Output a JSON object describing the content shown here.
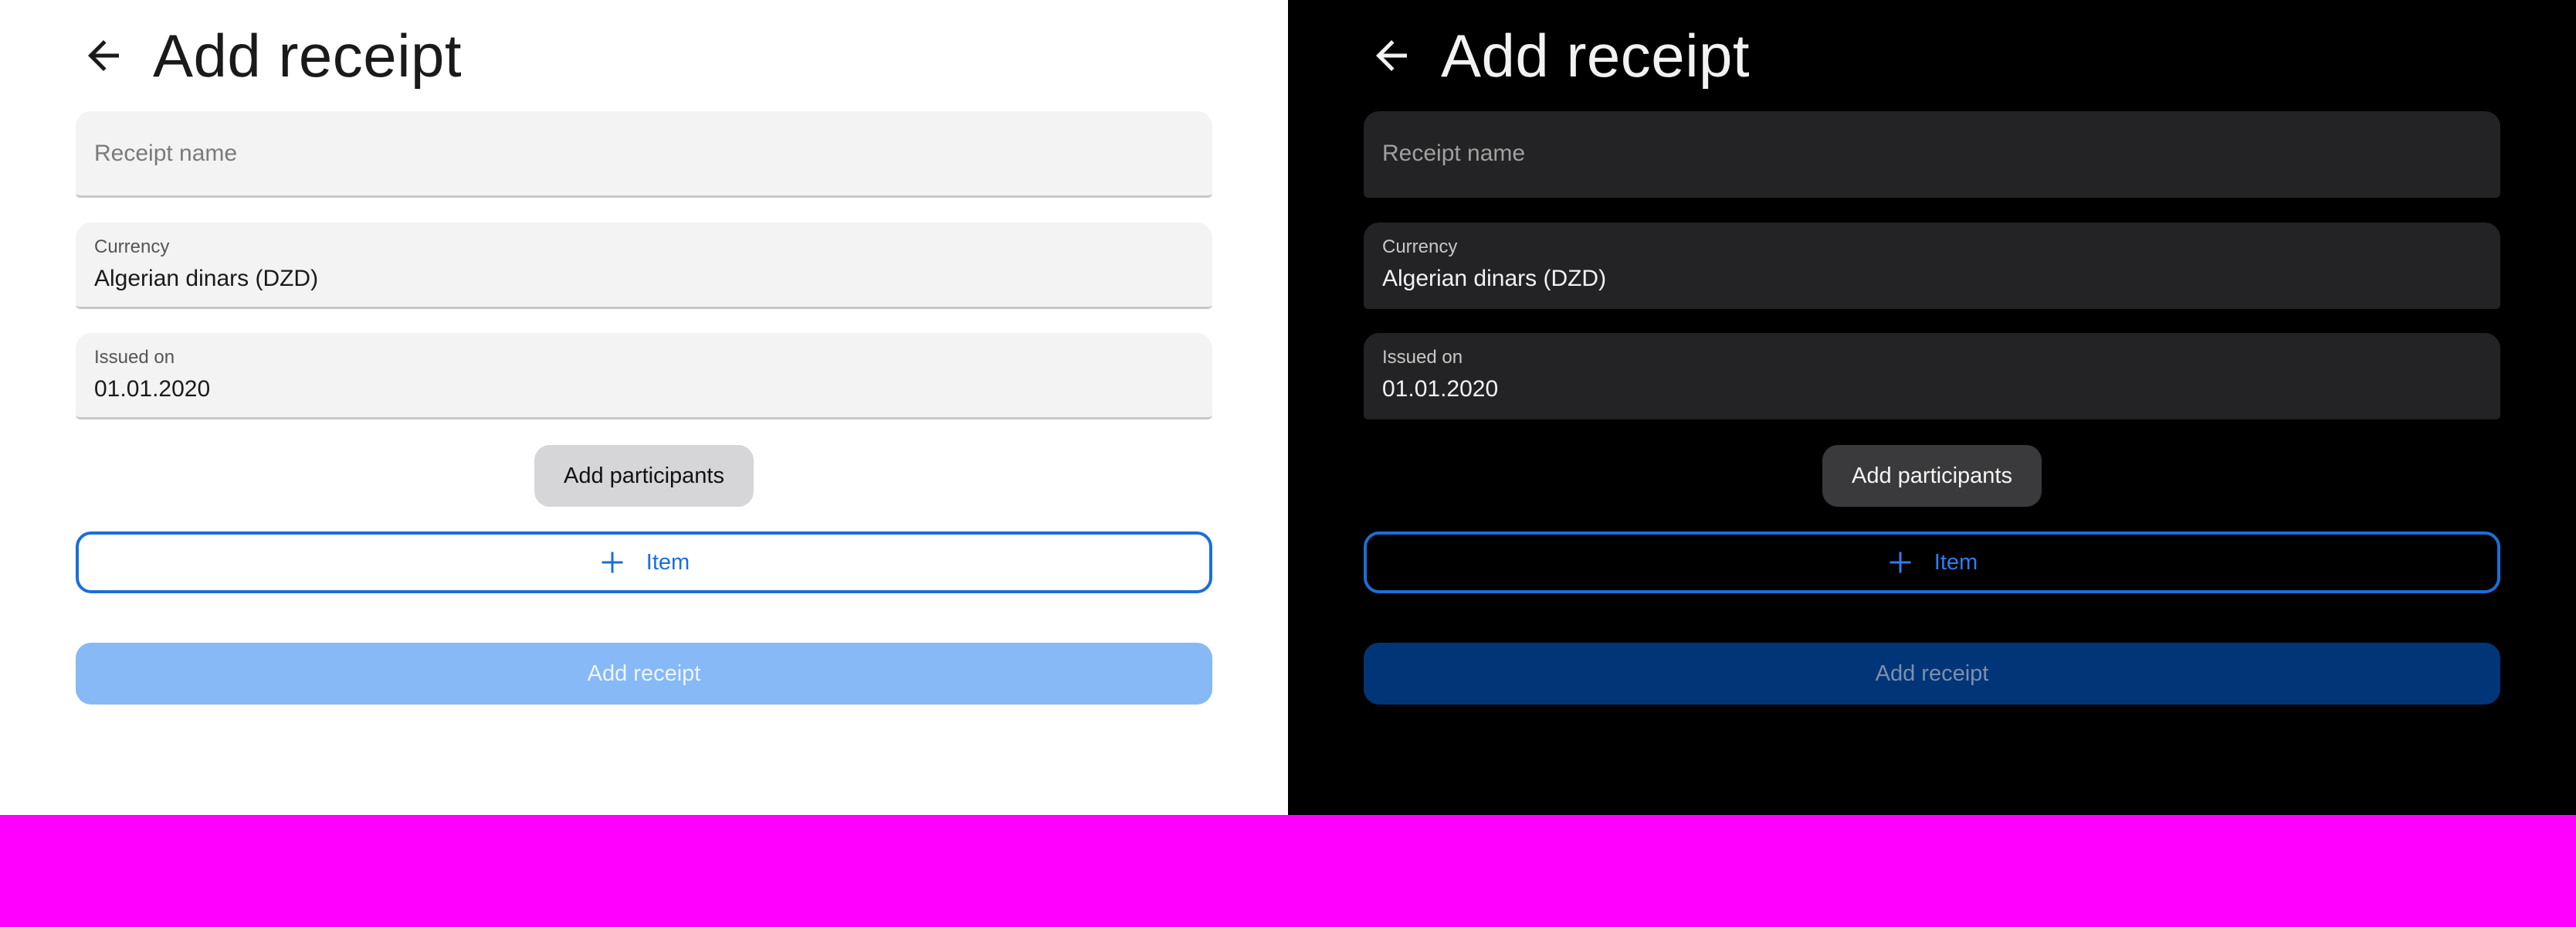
{
  "light": {
    "header": {
      "title": "Add receipt",
      "back_icon": "arrow-left-icon"
    },
    "receipt_name": {
      "placeholder": "Receipt name"
    },
    "currency": {
      "label": "Currency",
      "value": "Algerian dinars (DZD)"
    },
    "issued_on": {
      "label": "Issued on",
      "value": "01.01.2020"
    },
    "add_participants_label": "Add participants",
    "item_button": {
      "icon": "plus-icon",
      "label": "Item"
    },
    "submit_label": "Add receipt"
  },
  "dark": {
    "header": {
      "title": "Add receipt",
      "back_icon": "arrow-left-icon"
    },
    "receipt_name": {
      "placeholder": "Receipt name"
    },
    "currency": {
      "label": "Currency",
      "value": "Algerian dinars (DZD)"
    },
    "issued_on": {
      "label": "Issued on",
      "value": "01.01.2020"
    },
    "add_participants_label": "Add participants",
    "item_button": {
      "icon": "plus-icon",
      "label": "Item"
    },
    "submit_label": "Add receipt"
  },
  "colors": {
    "accent": "#1a6fd8",
    "light_background": "#ffffff",
    "dark_background": "#000000",
    "filler": "#ff00ff"
  }
}
